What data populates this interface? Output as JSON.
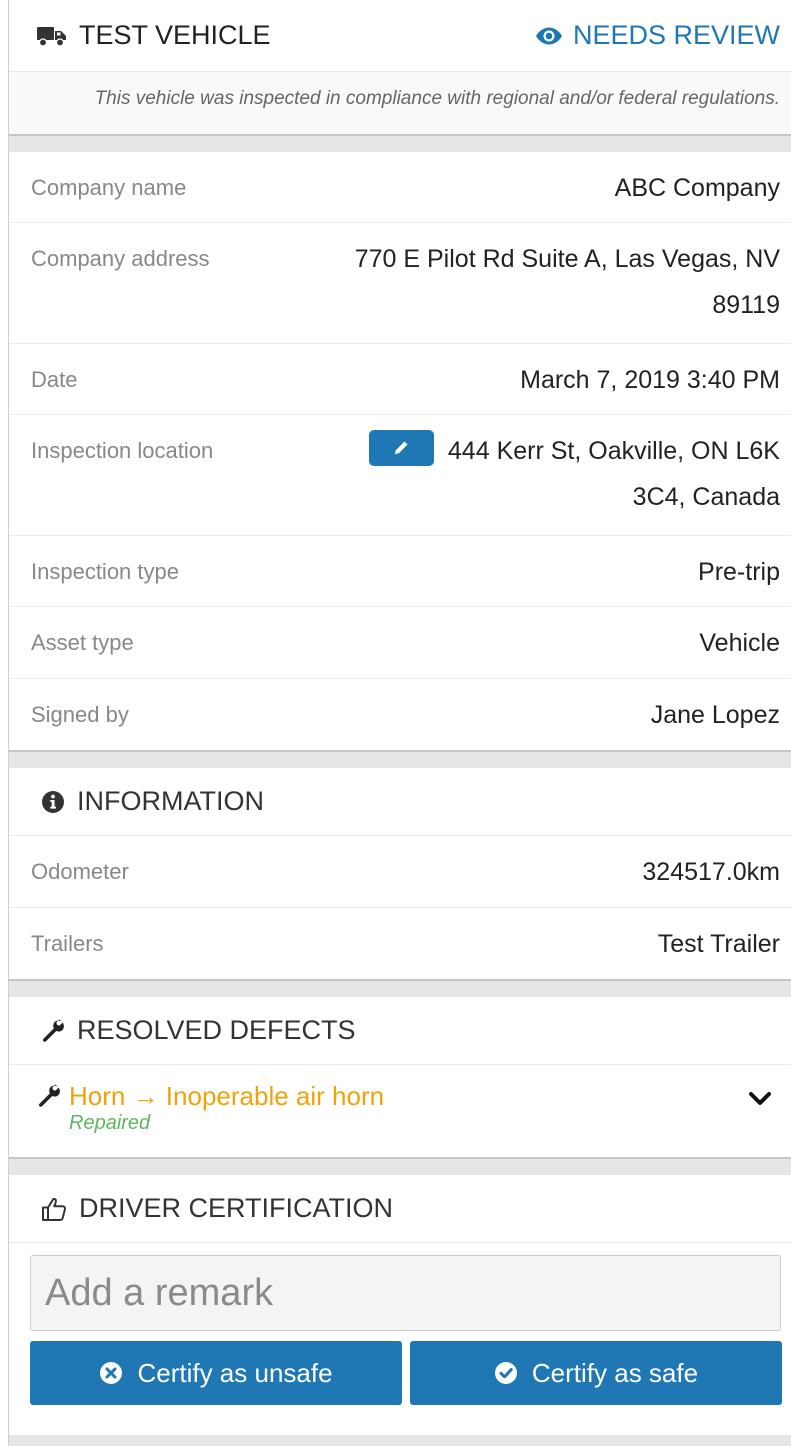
{
  "header": {
    "title": "TEST VEHICLE",
    "status": "NEEDS REVIEW",
    "compliance_note": "This vehicle was inspected in compliance with regional and/or federal regulations."
  },
  "details": [
    {
      "label": "Company name",
      "value": "ABC Company"
    },
    {
      "label": "Company address",
      "value": "770 E Pilot Rd Suite A, Las Vegas, NV 89119"
    },
    {
      "label": "Date",
      "value": "March 7, 2019 3:40 PM"
    },
    {
      "label": "Inspection location",
      "value": "444 Kerr St, Oakville, ON L6K 3C4, Canada"
    },
    {
      "label": "Inspection type",
      "value": "Pre-trip"
    },
    {
      "label": "Asset type",
      "value": "Vehicle"
    },
    {
      "label": "Signed by",
      "value": "Jane Lopez"
    }
  ],
  "information": {
    "title": "INFORMATION",
    "rows": [
      {
        "label": "Odometer",
        "value": "324517.0km"
      },
      {
        "label": "Trailers",
        "value": "Test Trailer"
      }
    ]
  },
  "resolved_defects": {
    "title": "RESOLVED DEFECTS",
    "items": [
      {
        "name": "Horn → Inoperable air horn",
        "status": "Repaired"
      }
    ]
  },
  "certification": {
    "title": "DRIVER CERTIFICATION",
    "remark_placeholder": "Add a remark",
    "unsafe_label": "Certify as unsafe",
    "safe_label": "Certify as safe"
  },
  "colors": {
    "accent": "#1f77b4",
    "defect": "#f0a20a",
    "repaired": "#5cb85c"
  },
  "icons": [
    "truck-icon",
    "eye-icon",
    "pencil-icon",
    "info-circle-icon",
    "wrench-icon",
    "chevron-down-icon",
    "thumbs-up-icon",
    "times-circle-icon",
    "check-circle-icon"
  ]
}
